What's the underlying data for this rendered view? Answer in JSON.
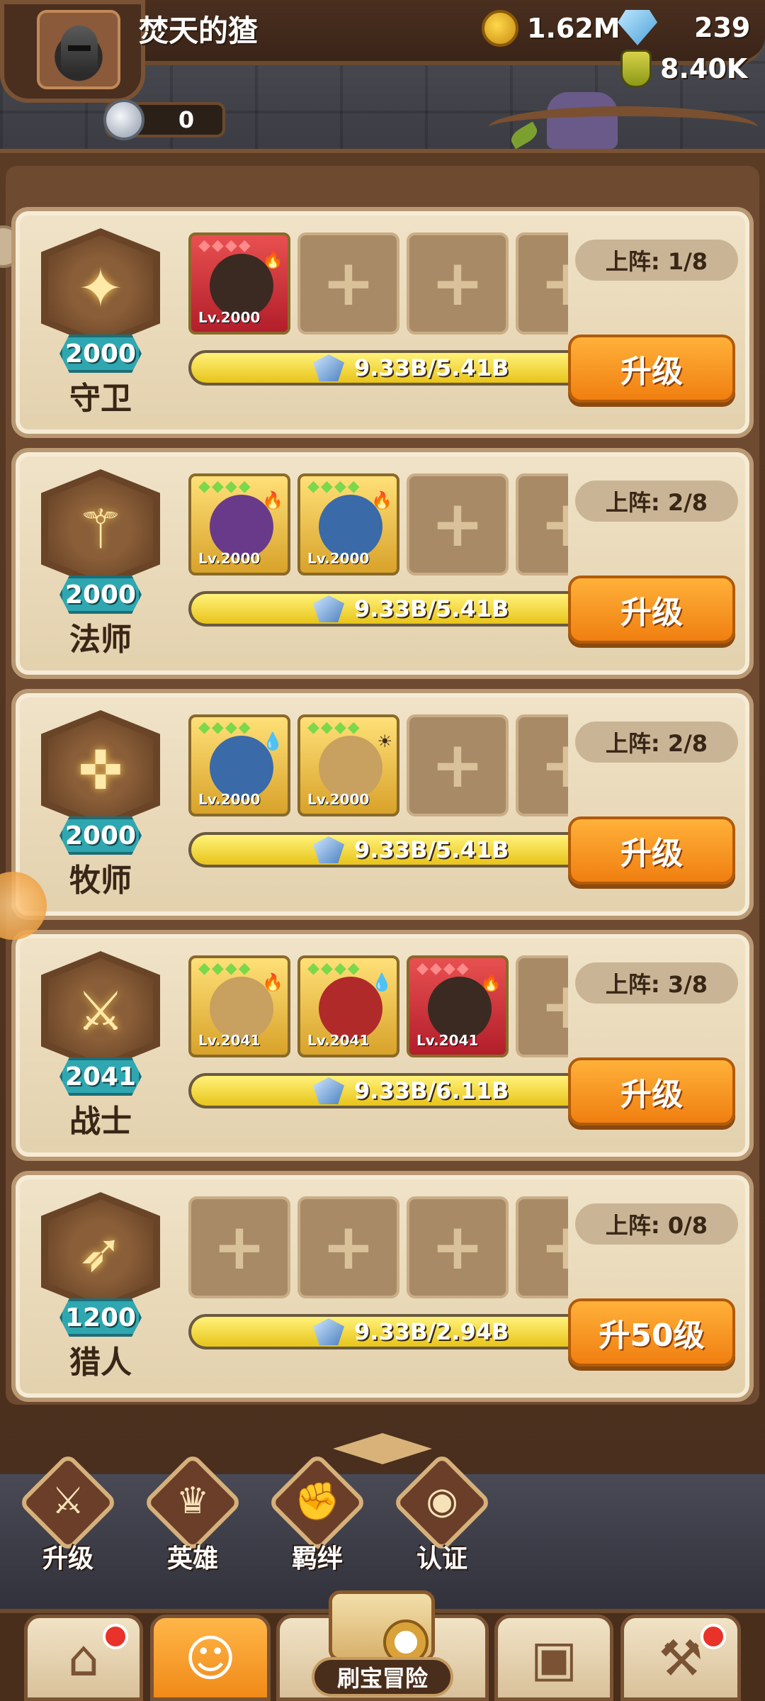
{
  "header": {
    "player_name": "焚天的猹",
    "gold": "1.62M",
    "diamonds": "239",
    "potions": "8.40K",
    "silver": "0"
  },
  "rows": [
    {
      "class_name": "守卫",
      "class_level": "2000",
      "lineup": "上阵: 1/8",
      "exp": "9.33B/5.41B",
      "exp_fraction": 1.0,
      "button": "升级",
      "icon": "shield-icon",
      "heroes": [
        {
          "level": "Lv.2000",
          "frame": "red",
          "element": "fire"
        }
      ]
    },
    {
      "class_name": "法师",
      "class_level": "2000",
      "lineup": "上阵: 2/8",
      "exp": "9.33B/5.41B",
      "exp_fraction": 1.0,
      "button": "升级",
      "icon": "staff-icon",
      "heroes": [
        {
          "level": "Lv.2000",
          "frame": "gold",
          "element": "fire"
        },
        {
          "level": "Lv.2000",
          "frame": "gold",
          "element": "fire"
        }
      ]
    },
    {
      "class_name": "牧师",
      "class_level": "2000",
      "lineup": "上阵: 2/8",
      "exp": "9.33B/5.41B",
      "exp_fraction": 1.0,
      "button": "升级",
      "icon": "holy-cross-icon",
      "heroes": [
        {
          "level": "Lv.2000",
          "frame": "gold",
          "element": "water"
        },
        {
          "level": "Lv.2000",
          "frame": "gold",
          "element": "light"
        }
      ]
    },
    {
      "class_name": "战士",
      "class_level": "2041",
      "lineup": "上阵: 3/8",
      "exp": "9.33B/6.11B",
      "exp_fraction": 1.0,
      "button": "升级",
      "icon": "sword-icon",
      "heroes": [
        {
          "level": "Lv.2041",
          "frame": "gold",
          "element": "fire"
        },
        {
          "level": "Lv.2041",
          "frame": "gold",
          "element": "water"
        },
        {
          "level": "Lv.2041",
          "frame": "red",
          "element": "fire"
        }
      ]
    },
    {
      "class_name": "猎人",
      "class_level": "1200",
      "lineup": "上阵: 0/8",
      "exp": "9.33B/2.94B",
      "exp_fraction": 1.0,
      "button": "升50级",
      "icon": "bow-icon",
      "heroes": []
    }
  ],
  "actions": [
    {
      "label": "升级",
      "icon": "upgrade-sword-icon"
    },
    {
      "label": "英雄",
      "icon": "hero-icon"
    },
    {
      "label": "羁绊",
      "icon": "bond-fist-icon"
    },
    {
      "label": "认证",
      "icon": "eye-icon"
    }
  ],
  "nav": {
    "adventure_label": "刷宝冒险",
    "items": [
      {
        "name": "shop",
        "icon": "shop-icon",
        "badge": true
      },
      {
        "name": "heroes",
        "icon": "hero-avatar-icon",
        "badge": false,
        "active": true
      },
      {
        "name": "adventure",
        "icon": "map-icon",
        "badge": false
      },
      {
        "name": "bag",
        "icon": "backpack-icon",
        "badge": false
      },
      {
        "name": "forge",
        "icon": "hammer-icon",
        "badge": true
      }
    ]
  },
  "colors": {
    "accent_orange": "#f08a18",
    "progress_yellow": "#f2d84a",
    "level_teal": "#2fa7b0"
  }
}
